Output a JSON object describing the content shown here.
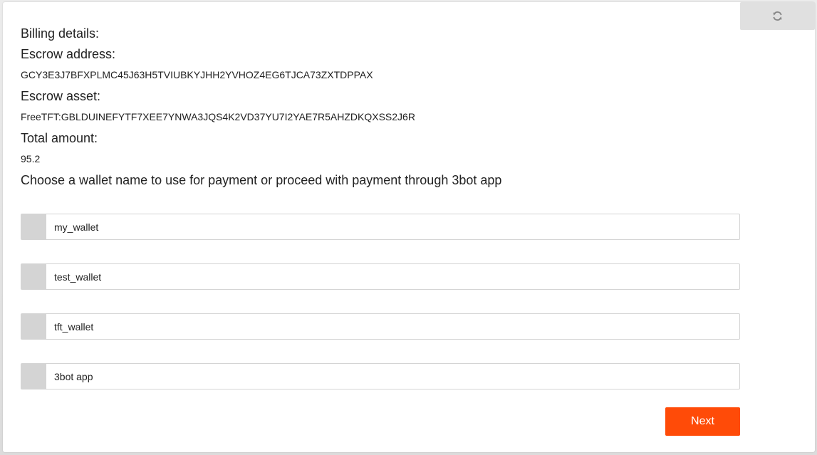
{
  "billing": {
    "heading": "Billing details:",
    "escrow_address_label": "Escrow address:",
    "escrow_address_value": "GCY3E3J7BFXPLMC45J63H5TVIUBKYJHH2YVHOZ4EG6TJCA73ZXTDPPAX",
    "escrow_asset_label": "Escrow asset:",
    "escrow_asset_value": "FreeTFT:GBLDUINEFYTF7XEE7YNWA3JQS4K2VD37YU7I2YAE7R5AHZDKQXSS2J6R",
    "total_amount_label": "Total amount:",
    "total_amount_value": "95.2"
  },
  "wallet_prompt": "Choose a wallet name to use for payment or proceed with payment through 3bot app",
  "wallet_options": [
    {
      "label": "my_wallet"
    },
    {
      "label": "test_wallet"
    },
    {
      "label": "tft_wallet"
    },
    {
      "label": "3bot app"
    }
  ],
  "actions": {
    "next_label": "Next",
    "refresh_icon": "refresh-icon"
  },
  "colors": {
    "accent": "#ff4b08",
    "radio_box": "#d4d4d4",
    "refresh_bg": "#e0e0e0"
  }
}
